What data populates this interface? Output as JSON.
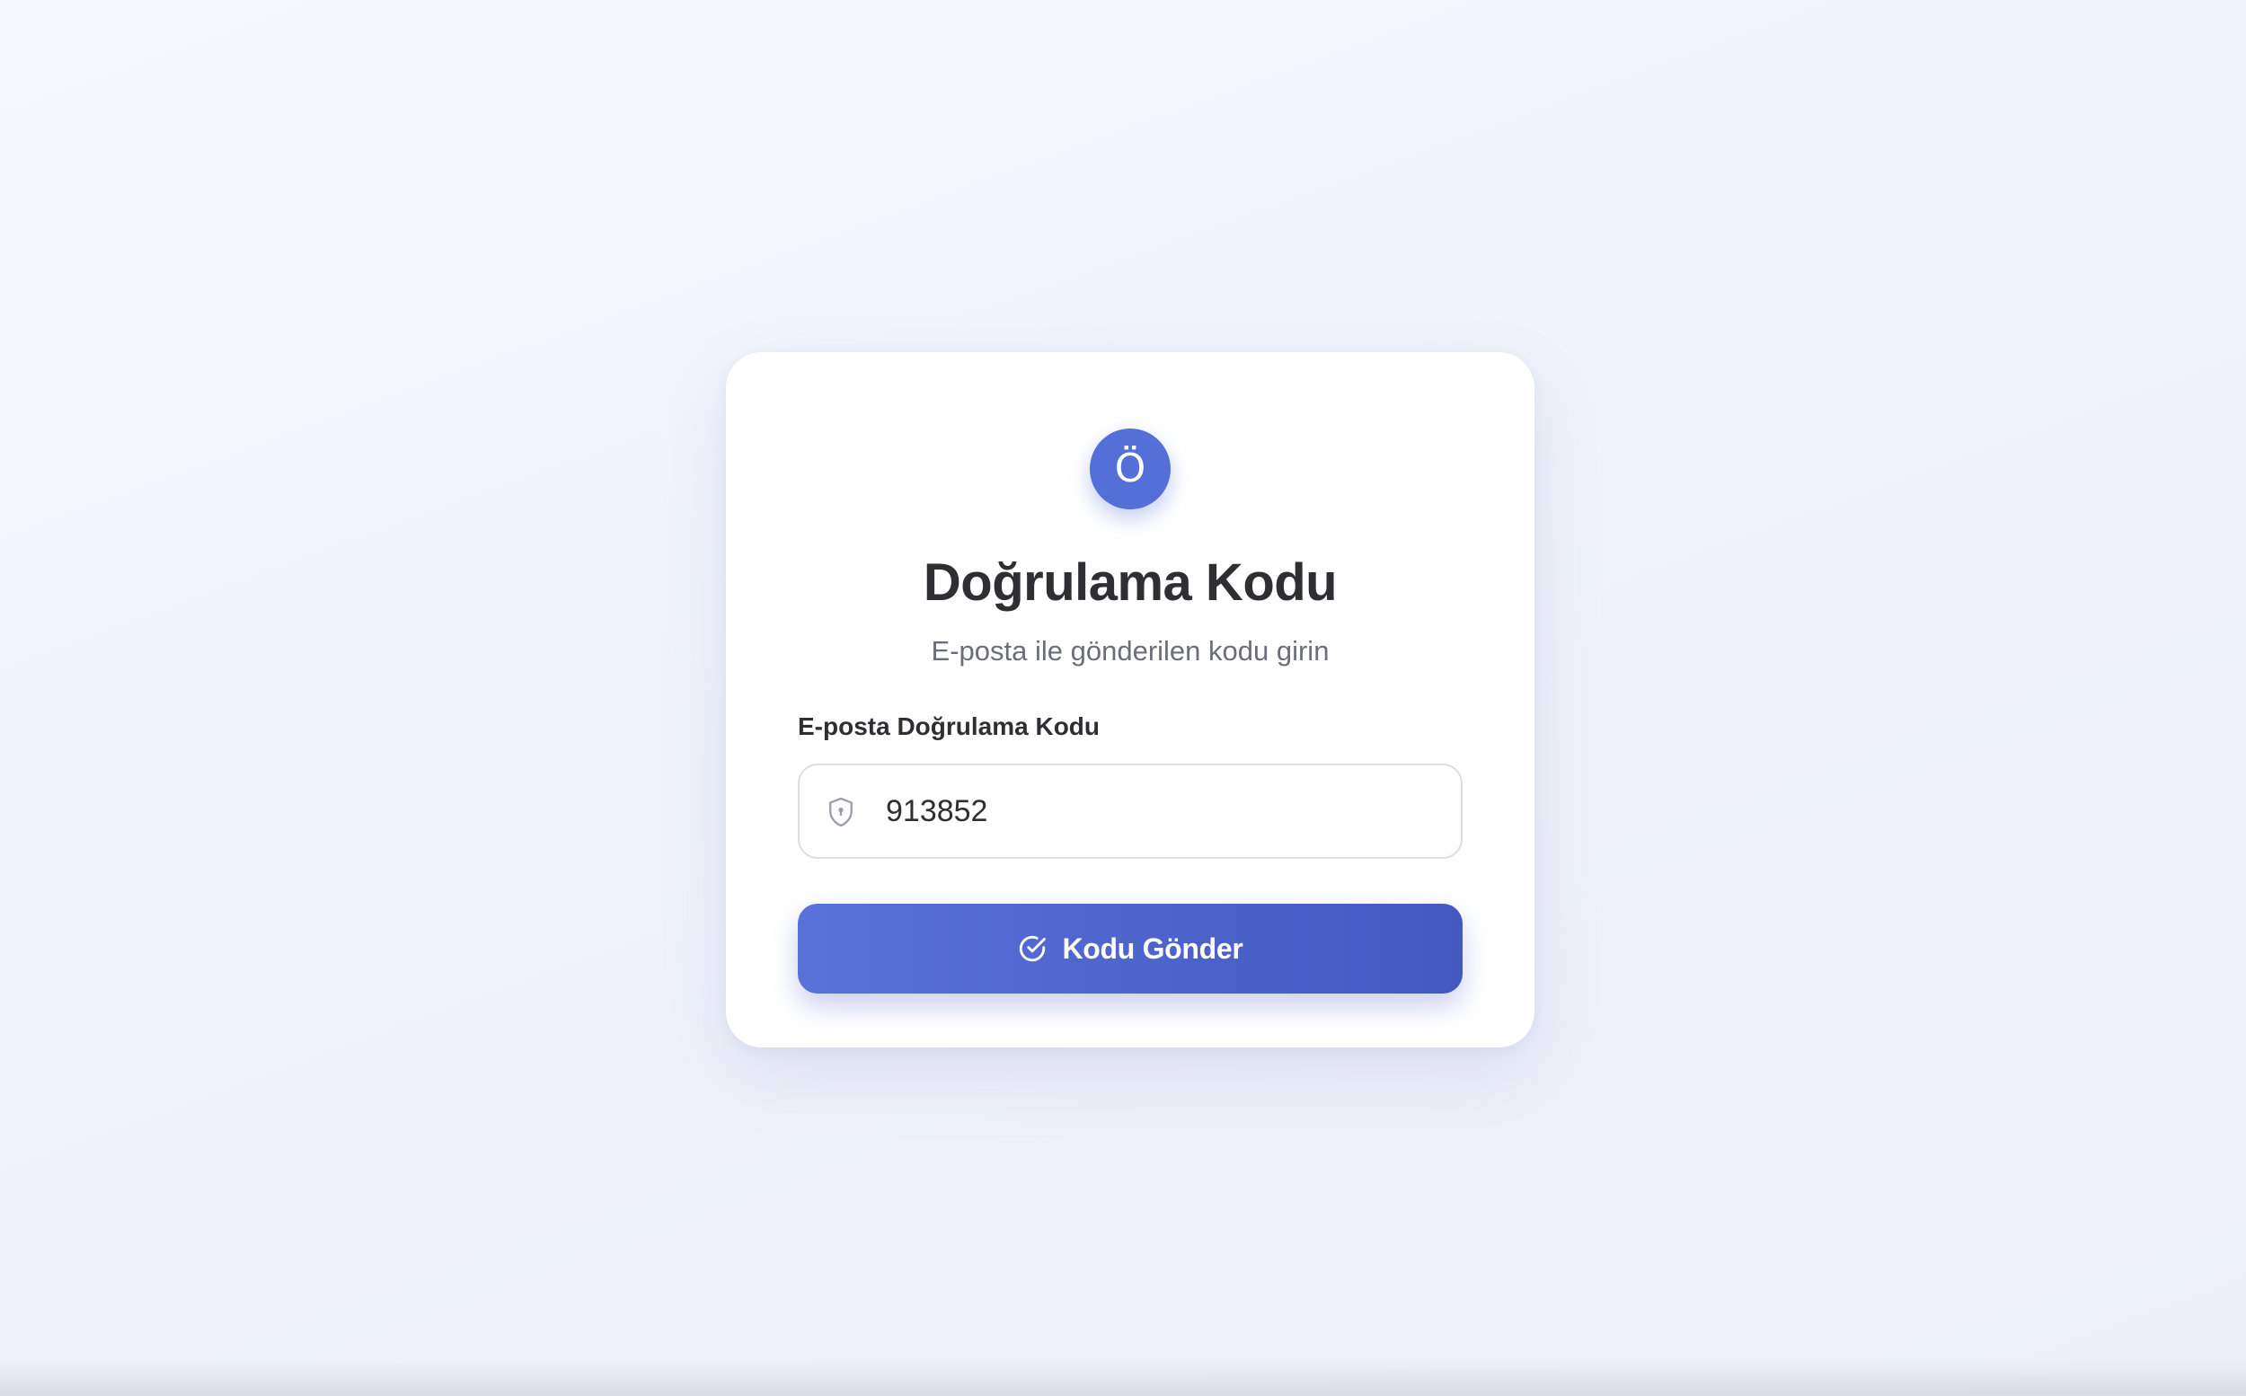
{
  "avatar": {
    "initial": "Ö",
    "color": "#5470d8"
  },
  "header": {
    "title": "Doğrulama Kodu",
    "subtitle": "E-posta ile gönderilen kodu girin"
  },
  "form": {
    "code_label": "E-posta Doğrulama Kodu",
    "code_value": "913852",
    "code_icon": "shield-icon",
    "submit_label": "Kodu Gönder",
    "submit_icon": "check-circle-icon"
  },
  "colors": {
    "accent": "#5470d8",
    "button_gradient_start": "#5872d8",
    "button_gradient_end": "#4458c2",
    "text_primary": "#2f2f33",
    "text_secondary": "#6b6e78"
  }
}
